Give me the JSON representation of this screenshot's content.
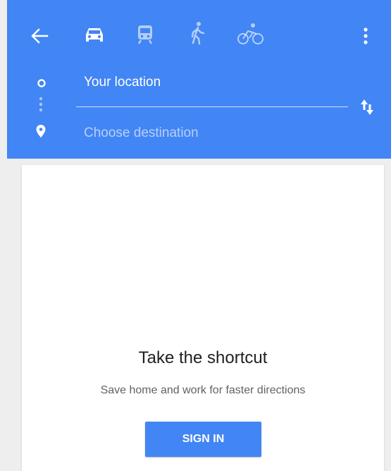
{
  "header": {
    "background_color": "#4285f4",
    "back_icon": "arrow-back-icon",
    "more_icon": "more-vert-icon",
    "swap_icon": "swap-icon",
    "travel_modes": [
      {
        "name": "driving",
        "icon": "car-icon",
        "selected": true
      },
      {
        "name": "transit",
        "icon": "train-icon",
        "selected": false
      },
      {
        "name": "walking",
        "icon": "walk-icon",
        "selected": false
      },
      {
        "name": "cycling",
        "icon": "bike-icon",
        "selected": false
      }
    ]
  },
  "origin": {
    "value": "Your location",
    "icon": "origin-dot-icon"
  },
  "destination": {
    "placeholder": "Choose destination",
    "icon": "pin-icon"
  },
  "card": {
    "title": "Take the shortcut",
    "subtitle": "Save home and work for faster directions",
    "signin_label": "SIGN IN",
    "button_color": "#4285f4"
  }
}
